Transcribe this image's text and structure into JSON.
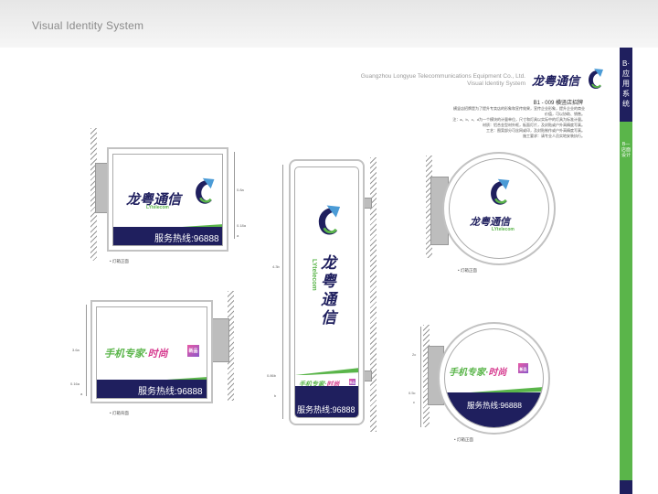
{
  "header": {
    "title": "Visual Identity System"
  },
  "sidebar": {
    "section": "B·应用系统",
    "subsection": "B—店面设计"
  },
  "brand": {
    "company_en": "Guangzhou Longyue Telecommunications Equipment Co., Ltd.",
    "vis_en": "Visual Identity System",
    "logo_cn": "龙粤通信",
    "logo_en": "LYtelecom"
  },
  "section": {
    "code_title": "B1 - 009 横竖店招牌",
    "desc_lines": [
      "横竖店招牌是为了提升专卖店的形象和宣传效果，宣传企业形象，提升企业的商业",
      "价值，可以协助、销售。",
      "注：a、b、c、d为一个模块的计量单位，尺寸和灯具以实际中的灯具为标准计量。",
      "材质：铝合金型材外框，板面灯片，及封贴或户外高精度写真。",
      "工艺：图案部分可丝网或印，及封贴制作或户外高精度写真。",
      "施工要求：请专业人员实地安装执行。"
    ]
  },
  "signs": {
    "hotline": "服务热线:96888",
    "slogan_a": "手机专家·",
    "slogan_b": "时尚",
    "cube_text": "新品",
    "captions": {
      "square_front": "• 灯箱正面",
      "square_back": "• 灯箱背面",
      "circle_front": "• 灯箱正面",
      "circle_back": "• 灯箱正面"
    },
    "dims": {
      "d1": "0.8a",
      "d2": "0.18a",
      "d3": "a",
      "d4": "3.6a",
      "d5": "0.16a",
      "d6": "4.3b",
      "d7": "0.86b",
      "d8": "b",
      "d9": "2c",
      "d10": "0.5c",
      "d11": "c"
    }
  }
}
